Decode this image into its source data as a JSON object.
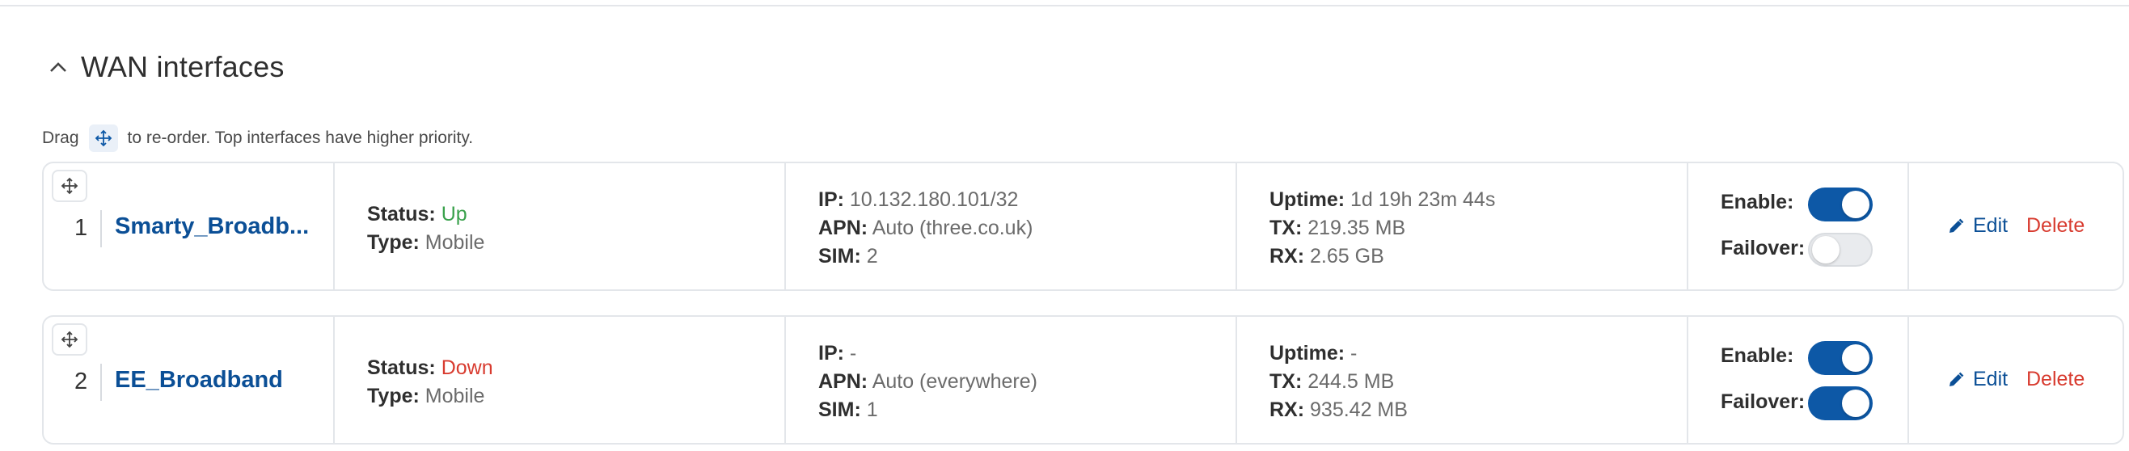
{
  "section": {
    "title": "WAN interfaces",
    "hint_before": "Drag",
    "hint_after": "to re-order. Top interfaces have higher priority."
  },
  "labels": {
    "status": "Status:",
    "type": "Type:",
    "ip": "IP:",
    "apn": "APN:",
    "sim": "SIM:",
    "uptime": "Uptime:",
    "tx": "TX:",
    "rx": "RX:",
    "enable": "Enable:",
    "failover": "Failover:",
    "edit": "Edit",
    "delete": "Delete"
  },
  "interfaces": [
    {
      "index": "1",
      "name": "Smarty_Broadb...",
      "status": "Up",
      "type": "Mobile",
      "ip": "10.132.180.101/32",
      "apn": "Auto (three.co.uk)",
      "sim": "2",
      "uptime": "1d 19h 23m 44s",
      "tx": "219.35 MB",
      "rx": "2.65 GB",
      "enable": true,
      "failover": false
    },
    {
      "index": "2",
      "name": "EE_Broadband",
      "status": "Down",
      "type": "Mobile",
      "ip": "-",
      "apn": "Auto (everywhere)",
      "sim": "1",
      "uptime": "-",
      "tx": "244.5 MB",
      "rx": "935.42 MB",
      "enable": true,
      "failover": true
    }
  ],
  "colors": {
    "accent": "#0d58a6",
    "link": "#0b4f96",
    "status_up": "#3aa14c",
    "status_down": "#d83b2f"
  },
  "icons": {
    "collapse": "chevron-up-icon",
    "drag": "move-arrows-icon",
    "edit": "pencil-icon"
  }
}
